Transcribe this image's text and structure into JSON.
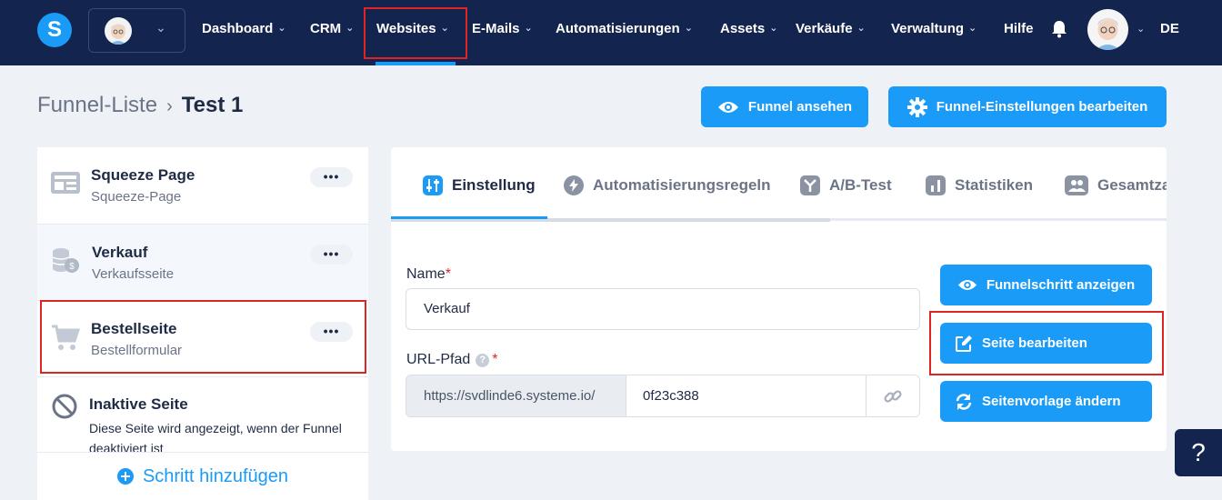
{
  "nav": {
    "logo_letter": "S",
    "items": [
      "Dashboard",
      "CRM",
      "Websites",
      "E-Mails",
      "Automatisierungen",
      "Assets",
      "Verkäufe",
      "Verwaltung"
    ],
    "help": "Hilfe",
    "language": "DE",
    "active_item": "Websites"
  },
  "breadcrumb": {
    "parent": "Funnel-Liste",
    "current": "Test 1"
  },
  "header_buttons": {
    "view_funnel": "Funnel ansehen",
    "funnel_settings": "Funnel-Einstellungen bearbeiten"
  },
  "steps": [
    {
      "title": "Squeeze Page",
      "subtitle": "Squeeze-Page",
      "icon": "page-layout-icon"
    },
    {
      "title": "Verkauf",
      "subtitle": "Verkaufsseite",
      "icon": "coins-icon"
    },
    {
      "title": "Bestellseite",
      "subtitle": "Bestellformular",
      "icon": "cart-icon"
    },
    {
      "title": "Inaktive Seite",
      "subtitle": "Diese Seite wird angezeigt, wenn der Funnel deaktiviert ist",
      "icon": "disabled-icon"
    }
  ],
  "step_menu": "•••",
  "add_step": "Schritt hinzufügen",
  "tabs": [
    "Einstellung",
    "Automatisierungsregeln",
    "A/B-Test",
    "Statistiken",
    "Gesamtza"
  ],
  "form": {
    "name_label": "Name",
    "name_value": "Verkauf",
    "url_label": "URL-Pfad",
    "url_prefix": "https://svdlinde6.systeme.io/",
    "url_slug": "0f23c388",
    "required_mark": "*",
    "help_mark": "?"
  },
  "actions": {
    "show_step": "Funnelschritt anzeigen",
    "edit_page": "Seite bearbeiten",
    "change_template": "Seitenvorlage ändern"
  },
  "help_fab": "?",
  "colors": {
    "nav_bg": "#13254f",
    "accent": "#1a9bf7",
    "highlight": "#e02424"
  }
}
